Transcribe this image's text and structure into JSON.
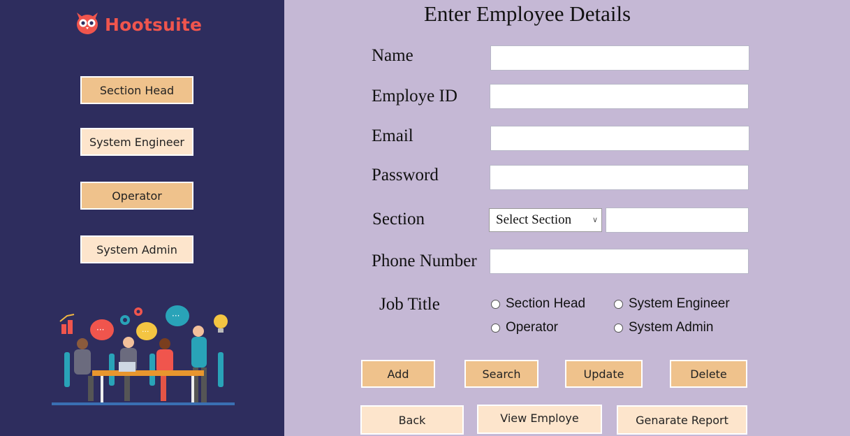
{
  "brand": {
    "name": "Hootsuite",
    "color": "#f0554d",
    "icon": "owl-icon"
  },
  "sidebar": {
    "buttons": [
      {
        "label": "Section Head"
      },
      {
        "label": "System Engineer"
      },
      {
        "label": "Operator"
      },
      {
        "label": "System Admin"
      }
    ],
    "illustration": "team-meeting-illustration"
  },
  "form": {
    "title": "Enter Employee Details",
    "fields": {
      "name": {
        "label": "Name",
        "value": ""
      },
      "employee_id": {
        "label": "Employe ID",
        "value": ""
      },
      "email": {
        "label": "Email",
        "value": ""
      },
      "password": {
        "label": "Password",
        "value": ""
      },
      "section": {
        "label": "Section",
        "selected": "Select Section",
        "value": ""
      },
      "phone": {
        "label": "Phone Number",
        "value": ""
      }
    },
    "job_title": {
      "label": "Job Title",
      "options": [
        "Section Head",
        "System Engineer",
        "Operator",
        "System Admin"
      ]
    }
  },
  "actions": {
    "add": "Add",
    "search": "Search",
    "update": "Update",
    "delete": "Delete",
    "back": "Back",
    "view": "View Employe",
    "report": "Genarate Report"
  },
  "colors": {
    "sidebar_bg": "#2e2d5e",
    "main_bg": "#c5b8d5",
    "button_orange": "#efc28c",
    "button_light": "#fde5cc"
  }
}
